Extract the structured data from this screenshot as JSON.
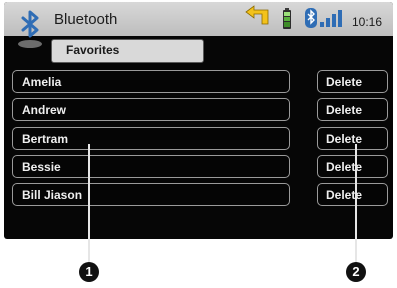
{
  "header": {
    "title": "Bluetooth",
    "favorites_label": "Favorites",
    "time": "10:16",
    "icons": [
      "bluetooth-logo-icon",
      "navigation-turn-arrow-icon",
      "battery-icon",
      "bluetooth-icon",
      "signal-strength-icon"
    ]
  },
  "contacts": [
    {
      "name": "Amelia",
      "action": "Delete"
    },
    {
      "name": "Andrew",
      "action": "Delete"
    },
    {
      "name": "Bertram",
      "action": "Delete"
    },
    {
      "name": "Bessie",
      "action": "Delete"
    },
    {
      "name": "Bill Jiason",
      "action": "Delete"
    }
  ],
  "callouts": [
    "1",
    "2"
  ],
  "colors": {
    "header_bg": "#c9c9c9",
    "screen_bg": "#060606",
    "arrow_yellow": "#f3c21b",
    "battery_green": "#59b03c",
    "bluetooth_blue": "#2f6db5"
  }
}
